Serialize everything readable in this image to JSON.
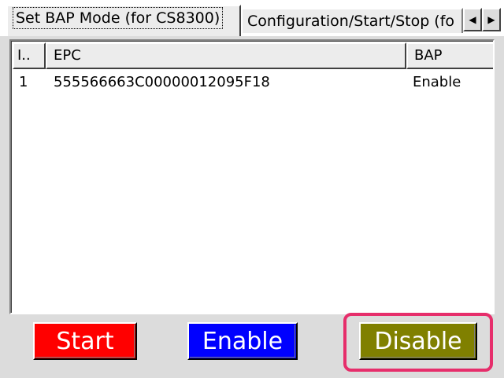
{
  "tabs": [
    {
      "label": "Set BAP Mode (for CS8300)",
      "active": true
    },
    {
      "label": "Configuration/Start/Stop (fo",
      "active": false
    }
  ],
  "tab_scroll": {
    "left_icon": "arrow-left-icon",
    "right_icon": "arrow-right-icon",
    "left_glyph": "◀",
    "right_glyph": "▶"
  },
  "listview": {
    "columns": [
      "I..",
      "EPC",
      "BAP"
    ],
    "rows": [
      {
        "id": "1",
        "epc": "555566663C00000012095F18",
        "bap": "Enable"
      }
    ]
  },
  "buttons": {
    "start_label": "Start",
    "enable_label": "Enable",
    "disable_label": "Disable"
  },
  "colors": {
    "start": "#ff0000",
    "enable": "#0000ff",
    "disable": "#808000",
    "highlight": "#e62e6b"
  }
}
